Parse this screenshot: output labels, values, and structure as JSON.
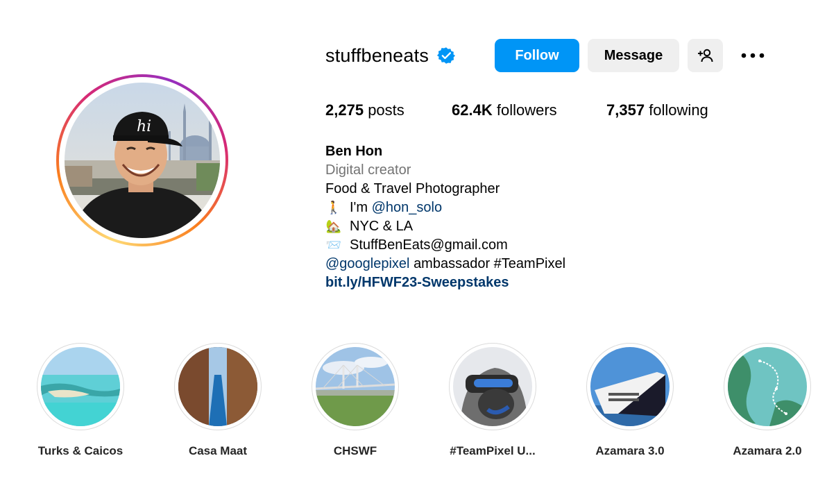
{
  "profile": {
    "username": "stuffbeneats",
    "verified": true,
    "buttons": {
      "follow": "Follow",
      "message": "Message"
    },
    "stats": {
      "posts_count": "2,275",
      "posts_label": "posts",
      "followers_count": "62.4K",
      "followers_label": "followers",
      "following_count": "7,357",
      "following_label": "following"
    },
    "bio": {
      "name": "Ben Hon",
      "category": "Digital creator",
      "line1": "Food & Travel Photographer",
      "line2_prefix": "I'm",
      "line2_mention": "@hon_solo",
      "line3": "NYC & LA",
      "line4": "StuffBenEats@gmail.com",
      "line5_mention": "@googlepixel",
      "line5_rest": "ambassador #TeamPixel",
      "link": "bit.ly/HFWF23-Sweepstakes"
    },
    "emojis": {
      "walking": "🚶",
      "house": "🏡",
      "envelope": "📨"
    }
  },
  "highlights": [
    {
      "label": "Turks & Caicos"
    },
    {
      "label": "Casa Maat"
    },
    {
      "label": "CHSWF"
    },
    {
      "label": "#TeamPixel U..."
    },
    {
      "label": "Azamara 3.0"
    },
    {
      "label": "Azamara 2.0"
    }
  ],
  "colors": {
    "follow_button": "#0095f6",
    "secondary_button": "#efefef",
    "link_text": "#00376b",
    "category_text": "#737373",
    "verified_badge": "#0095f6"
  },
  "icons": [
    "verified-badge-icon",
    "add-user-icon",
    "more-options-icon"
  ]
}
